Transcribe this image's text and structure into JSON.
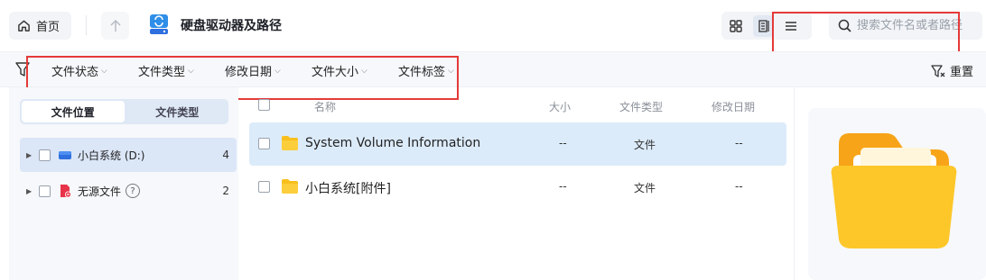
{
  "toolbar": {
    "home_label": "首页",
    "title": "硬盘驱动器及路径",
    "search_placeholder": "搜索文件名或者路径",
    "view_icons": [
      "grid-view-icon",
      "detail-view-icon",
      "list-view-icon"
    ]
  },
  "filters": {
    "items": [
      "文件状态",
      "文件类型",
      "修改日期",
      "文件大小",
      "文件标签"
    ],
    "reset_label": "重置"
  },
  "sidebar": {
    "tabs": [
      "文件位置",
      "文件类型"
    ],
    "active_tab": 0,
    "items": [
      {
        "label": "小白系统 (D:)",
        "count": "4",
        "icon": "drive-icon"
      },
      {
        "label": "无源文件",
        "count": "2",
        "icon": "orphan-file-icon",
        "help": "?"
      }
    ]
  },
  "list": {
    "headers": {
      "name": "名称",
      "size": "大小",
      "type": "文件类型",
      "modified": "修改日期"
    },
    "rows": [
      {
        "name": "System Volume Information",
        "size": "--",
        "type": "文件",
        "modified": "--"
      },
      {
        "name": "小白系统[附件]",
        "size": "--",
        "type": "文件",
        "modified": "--"
      }
    ]
  },
  "colors": {
    "accent": "#2f6fdf",
    "annotation": "#e53a3a",
    "folder": "#f9bf1e",
    "selected_row": "#dcebfa"
  }
}
